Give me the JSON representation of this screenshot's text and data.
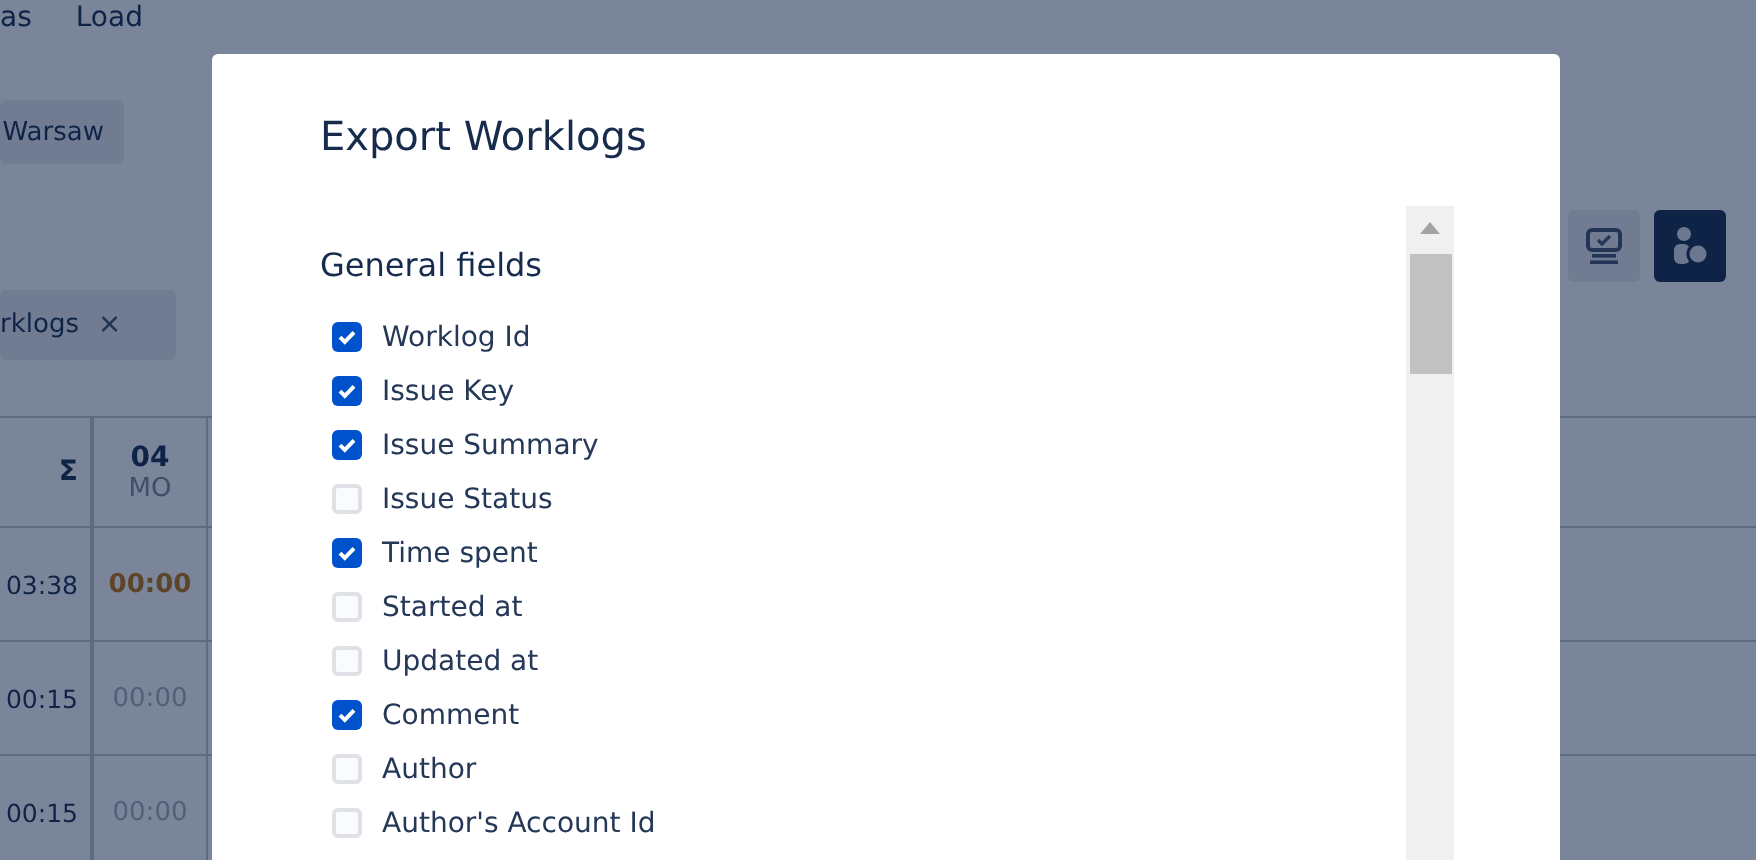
{
  "menu": [
    {
      "label": "as"
    },
    {
      "label": "Load"
    }
  ],
  "location_button": {
    "label": "Warsaw"
  },
  "filter_chip": {
    "label": "rklogs",
    "close": "×"
  },
  "view_toggles": [
    {
      "kind": "monitor",
      "selected": false
    },
    {
      "kind": "people",
      "selected": true
    }
  ],
  "table": {
    "total_header": "Σ",
    "day_header": {
      "day": "04",
      "weekday": "MO"
    },
    "rows": [
      {
        "total": "03:38",
        "day_value": "00:00",
        "highlight": true
      },
      {
        "total": "00:15",
        "day_value": "00:00",
        "highlight": false
      },
      {
        "total": "00:15",
        "day_value": "00:00",
        "highlight": false
      }
    ]
  },
  "dialog": {
    "title": "Export Worklogs",
    "section": "General fields",
    "fields": [
      {
        "label": "Worklog Id",
        "checked": true
      },
      {
        "label": "Issue Key",
        "checked": true
      },
      {
        "label": "Issue Summary",
        "checked": true
      },
      {
        "label": "Issue Status",
        "checked": false
      },
      {
        "label": "Time spent",
        "checked": true
      },
      {
        "label": "Started at",
        "checked": false
      },
      {
        "label": "Updated at",
        "checked": false
      },
      {
        "label": "Comment",
        "checked": true
      },
      {
        "label": "Author",
        "checked": false
      },
      {
        "label": "Author's Account Id",
        "checked": false
      }
    ]
  }
}
